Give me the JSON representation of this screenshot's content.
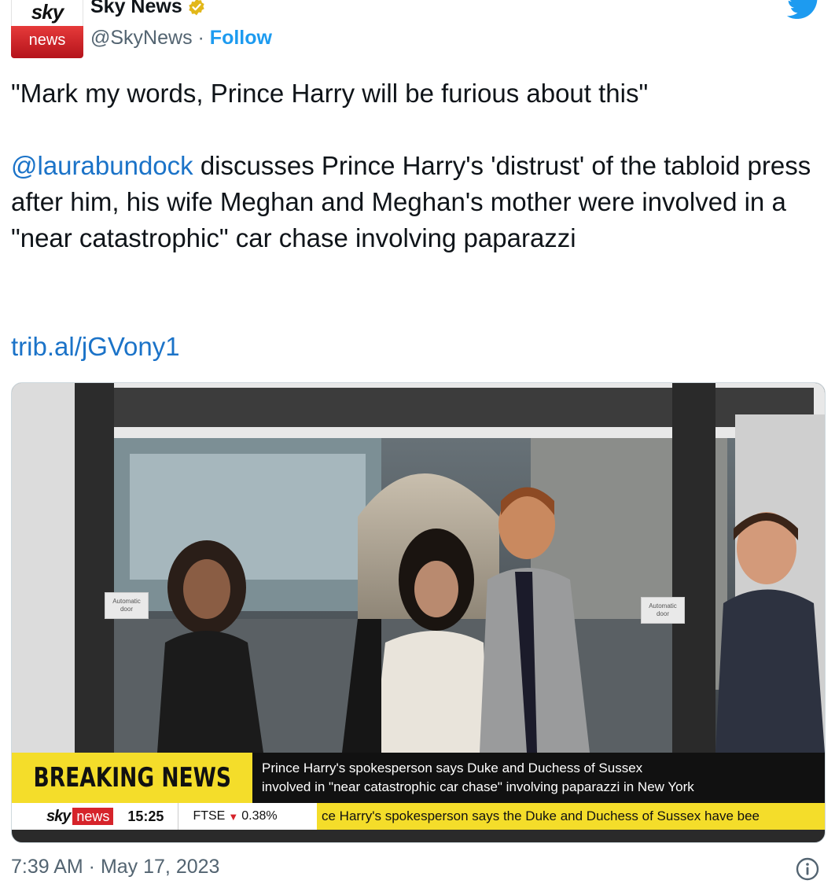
{
  "tweet": {
    "account": {
      "logo_top": "sky",
      "logo_bottom": "news",
      "name": "Sky News",
      "handle": "@SkyNews",
      "separator": " · ",
      "follow": "Follow"
    },
    "quote": "\"Mark my words, Prince Harry will be furious about this\"",
    "mention": "@laurabundock",
    "body": " discusses Prince Harry's 'distrust' of the tabloid press after him, his wife Meghan and Meghan's mother were involved in a \"near catastrophic\" car chase involving paparazzi",
    "link": "trib.al/jGVony1",
    "timestamp": "7:39 AM · May 17, 2023"
  },
  "video": {
    "door_sign_left": "Automatic door",
    "door_sign_right": "Automatic door",
    "breaking_label": "BREAKING NEWS",
    "breaking_text_line1": "Prince Harry's spokesperson says Duke and Duchess of Sussex",
    "breaking_text_line2": "involved in \"near catastrophic car chase\" involving paparazzi in New York",
    "ticker": {
      "sky": "sky",
      "news": "news",
      "time": "15:25",
      "ftse": "FTSE",
      "ftse_change": "0.38%",
      "scroll_text": "ce Harry's spokesperson says the Duke and Duchess of Sussex have bee"
    }
  },
  "colors": {
    "link": "#1b73c8",
    "follow": "#1d9bf0",
    "breaking_yellow": "#f4dd2a",
    "sky_red": "#d6232a"
  },
  "icons": [
    "verified-badge-icon",
    "twitter-bird-icon",
    "info-icon",
    "down-arrow-icon"
  ]
}
